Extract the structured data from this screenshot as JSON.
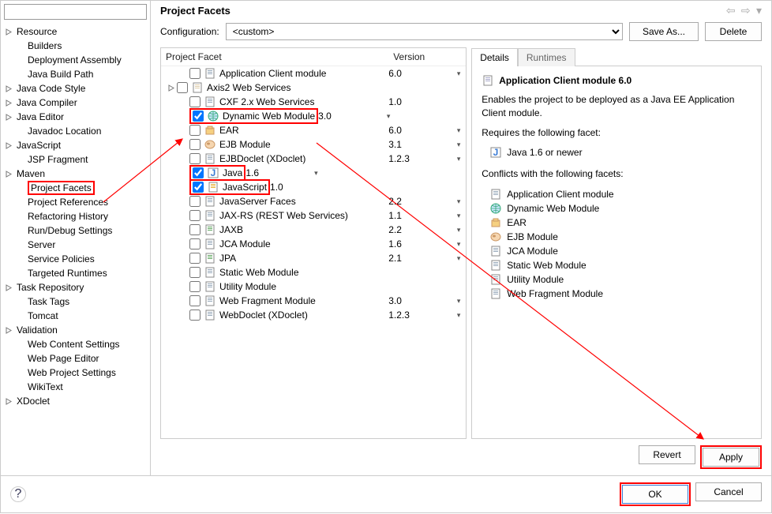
{
  "title": "Project Facets",
  "sidebar": {
    "filter_placeholder": "",
    "items": [
      {
        "label": "Resource",
        "expandable": true,
        "indent": false
      },
      {
        "label": "Builders",
        "expandable": false,
        "indent": true
      },
      {
        "label": "Deployment Assembly",
        "expandable": false,
        "indent": true
      },
      {
        "label": "Java Build Path",
        "expandable": false,
        "indent": true
      },
      {
        "label": "Java Code Style",
        "expandable": true,
        "indent": false
      },
      {
        "label": "Java Compiler",
        "expandable": true,
        "indent": false
      },
      {
        "label": "Java Editor",
        "expandable": true,
        "indent": false
      },
      {
        "label": "Javadoc Location",
        "expandable": false,
        "indent": true
      },
      {
        "label": "JavaScript",
        "expandable": true,
        "indent": false
      },
      {
        "label": "JSP Fragment",
        "expandable": false,
        "indent": true
      },
      {
        "label": "Maven",
        "expandable": true,
        "indent": false
      },
      {
        "label": "Project Facets",
        "expandable": false,
        "indent": true,
        "highlight": true
      },
      {
        "label": "Project References",
        "expandable": false,
        "indent": true
      },
      {
        "label": "Refactoring History",
        "expandable": false,
        "indent": true
      },
      {
        "label": "Run/Debug Settings",
        "expandable": false,
        "indent": true
      },
      {
        "label": "Server",
        "expandable": false,
        "indent": true
      },
      {
        "label": "Service Policies",
        "expandable": false,
        "indent": true
      },
      {
        "label": "Targeted Runtimes",
        "expandable": false,
        "indent": true
      },
      {
        "label": "Task Repository",
        "expandable": true,
        "indent": false
      },
      {
        "label": "Task Tags",
        "expandable": false,
        "indent": true
      },
      {
        "label": "Tomcat",
        "expandable": false,
        "indent": true
      },
      {
        "label": "Validation",
        "expandable": true,
        "indent": false
      },
      {
        "label": "Web Content Settings",
        "expandable": false,
        "indent": true
      },
      {
        "label": "Web Page Editor",
        "expandable": false,
        "indent": true
      },
      {
        "label": "Web Project Settings",
        "expandable": false,
        "indent": true
      },
      {
        "label": "WikiText",
        "expandable": false,
        "indent": true
      },
      {
        "label": "XDoclet",
        "expandable": true,
        "indent": false
      }
    ]
  },
  "config": {
    "label": "Configuration:",
    "value": "<custom>",
    "save_as": "Save As...",
    "delete": "Delete"
  },
  "facets": {
    "col_name": "Project Facet",
    "col_ver": "Version",
    "rows": [
      {
        "checked": false,
        "name": "Application Client module",
        "ver": "6.0",
        "dd": true,
        "icon": "doc",
        "child": true
      },
      {
        "checked": false,
        "name": "Axis2 Web Services",
        "ver": "",
        "dd": false,
        "icon": "folder",
        "child": false,
        "expandable": true
      },
      {
        "checked": false,
        "name": "CXF 2.x Web Services",
        "ver": "1.0",
        "dd": false,
        "icon": "doc",
        "child": true
      },
      {
        "checked": true,
        "name": "Dynamic Web Module",
        "ver": "3.0",
        "dd": true,
        "icon": "globe",
        "child": true,
        "highlight": true
      },
      {
        "checked": false,
        "name": "EAR",
        "ver": "6.0",
        "dd": true,
        "icon": "ear",
        "child": true
      },
      {
        "checked": false,
        "name": "EJB Module",
        "ver": "3.1",
        "dd": true,
        "icon": "bean",
        "child": true
      },
      {
        "checked": false,
        "name": "EJBDoclet (XDoclet)",
        "ver": "1.2.3",
        "dd": true,
        "icon": "doc",
        "child": true
      },
      {
        "checked": true,
        "name": "Java",
        "ver": "1.6",
        "dd": true,
        "icon": "java",
        "child": true,
        "highlight": true
      },
      {
        "checked": true,
        "name": "JavaScript",
        "ver": "1.0",
        "dd": false,
        "icon": "js",
        "child": true,
        "highlight": true
      },
      {
        "checked": false,
        "name": "JavaServer Faces",
        "ver": "2.2",
        "dd": true,
        "icon": "doc",
        "child": true
      },
      {
        "checked": false,
        "name": "JAX-RS (REST Web Services)",
        "ver": "1.1",
        "dd": true,
        "icon": "doc",
        "child": true
      },
      {
        "checked": false,
        "name": "JAXB",
        "ver": "2.2",
        "dd": true,
        "icon": "jaxb",
        "child": true
      },
      {
        "checked": false,
        "name": "JCA Module",
        "ver": "1.6",
        "dd": true,
        "icon": "doc",
        "child": true
      },
      {
        "checked": false,
        "name": "JPA",
        "ver": "2.1",
        "dd": true,
        "icon": "jpa",
        "child": true
      },
      {
        "checked": false,
        "name": "Static Web Module",
        "ver": "",
        "dd": false,
        "icon": "doc",
        "child": true
      },
      {
        "checked": false,
        "name": "Utility Module",
        "ver": "",
        "dd": false,
        "icon": "doc",
        "child": true
      },
      {
        "checked": false,
        "name": "Web Fragment Module",
        "ver": "3.0",
        "dd": true,
        "icon": "doc",
        "child": true
      },
      {
        "checked": false,
        "name": "WebDoclet (XDoclet)",
        "ver": "1.2.3",
        "dd": true,
        "icon": "doc",
        "child": true
      }
    ]
  },
  "details": {
    "tab_details": "Details",
    "tab_runtimes": "Runtimes",
    "heading": "Application Client module 6.0",
    "desc": "Enables the project to be deployed as a Java EE Application Client module.",
    "req_label": "Requires the following facet:",
    "req_items": [
      {
        "icon": "java",
        "label": "Java 1.6 or newer"
      }
    ],
    "conf_label": "Conflicts with the following facets:",
    "conf_items": [
      {
        "icon": "doc",
        "label": "Application Client module"
      },
      {
        "icon": "globe",
        "label": "Dynamic Web Module"
      },
      {
        "icon": "ear",
        "label": "EAR"
      },
      {
        "icon": "bean",
        "label": "EJB Module"
      },
      {
        "icon": "doc",
        "label": "JCA Module"
      },
      {
        "icon": "doc",
        "label": "Static Web Module"
      },
      {
        "icon": "doc",
        "label": "Utility Module"
      },
      {
        "icon": "doc",
        "label": "Web Fragment Module"
      }
    ]
  },
  "buttons": {
    "revert": "Revert",
    "apply": "Apply",
    "ok": "OK",
    "cancel": "Cancel"
  }
}
